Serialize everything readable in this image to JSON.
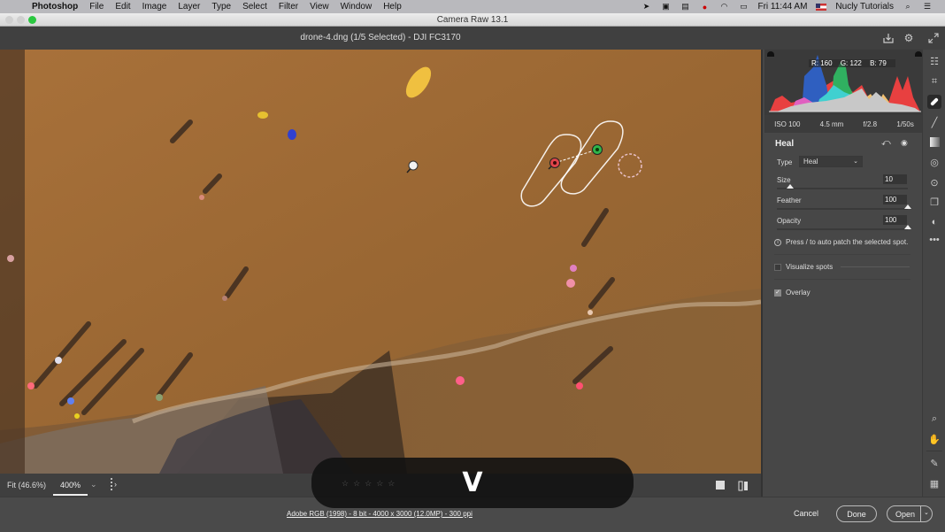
{
  "menubar": {
    "app_name": "Photoshop",
    "items": [
      "File",
      "Edit",
      "Image",
      "Layer",
      "Type",
      "Select",
      "Filter",
      "View",
      "Window",
      "Help"
    ],
    "clock": "Fri 11:44 AM",
    "user": "Nucly Tutorials"
  },
  "window": {
    "title": "Camera Raw 13.1",
    "document_title": "drone-4.dng (1/5 Selected)  -  DJI FC3170"
  },
  "histogram": {
    "r_label": "R:",
    "r": "160",
    "g_label": "G:",
    "g": "122",
    "b_label": "B:",
    "b": "79"
  },
  "exif": {
    "iso": "ISO 100",
    "focal": "4.5 mm",
    "aperture": "f/2.8",
    "shutter": "1/50s"
  },
  "heal_panel": {
    "title": "Heal",
    "type_label": "Type",
    "type_value": "Heal",
    "sliders": [
      {
        "label": "Size",
        "value": "10",
        "fraction": 0.1
      },
      {
        "label": "Feather",
        "value": "100",
        "fraction": 1.0
      },
      {
        "label": "Opacity",
        "value": "100",
        "fraction": 1.0
      }
    ],
    "hint": "Press / to auto patch the selected spot.",
    "visualize_spots_label": "Visualize spots",
    "visualize_spots_checked": false,
    "overlay_label": "Overlay",
    "overlay_checked": true
  },
  "image_toolbar": {
    "fit_label": "Fit (46.6%)",
    "zoom_value": "400%",
    "zoom_caret": "⌄"
  },
  "footer": {
    "workflow_options": "Adobe RGB (1998) - 8 bit - 4000 x 3000 (12.0MP) - 300 ppi",
    "cancel_label": "Cancel",
    "done_label": "Done",
    "open_label": "Open"
  },
  "key_overlay": {
    "key": "V",
    "stars": "☆☆☆☆☆"
  },
  "colors": {
    "accent_green": "#2ac840",
    "heal_source_pin": "#2fb54a",
    "heal_target_pin": "#e0454a",
    "panel_bg": "#474747"
  }
}
